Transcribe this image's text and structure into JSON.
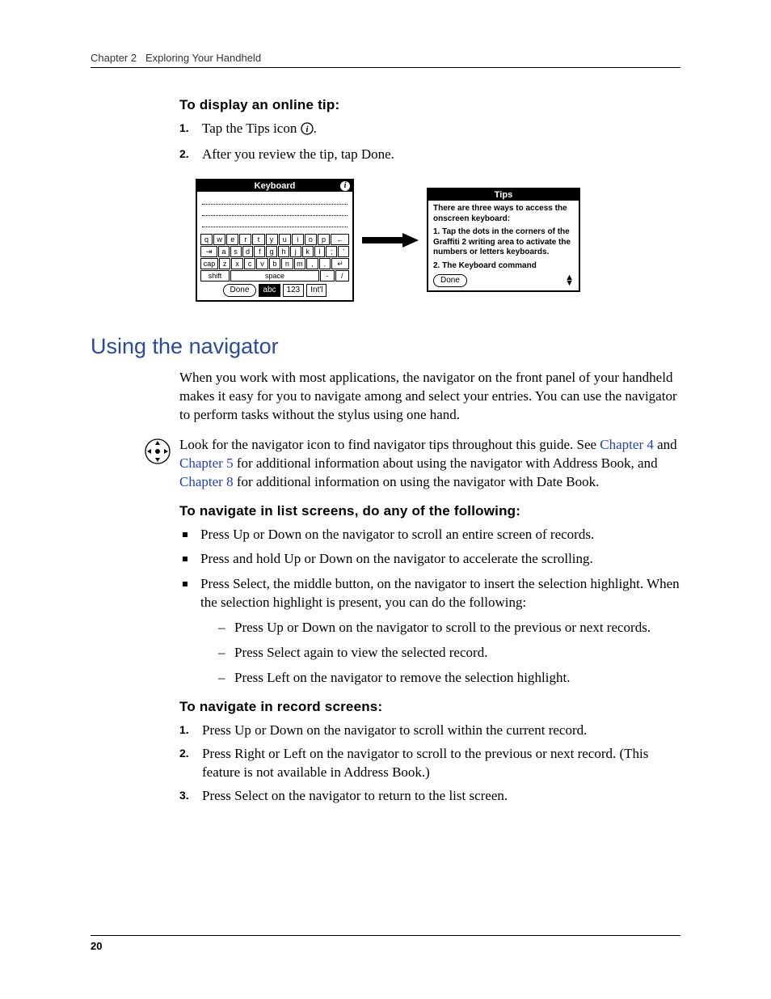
{
  "runningHead": {
    "chapter": "Chapter 2",
    "title": "Exploring Your Handheld"
  },
  "pageNumber": "20",
  "tip": {
    "heading": "To display an online tip:",
    "steps": [
      "Tap the Tips icon ",
      "After you review the tip, tap Done."
    ]
  },
  "figure": {
    "keyboard": {
      "title": "Keyboard",
      "rows": {
        "r1": [
          "q",
          "w",
          "e",
          "r",
          "t",
          "y",
          "u",
          "i",
          "o",
          "p",
          "←"
        ],
        "r2": [
          "⇥",
          "a",
          "s",
          "d",
          "f",
          "g",
          "h",
          "j",
          "k",
          "l",
          ";",
          "'"
        ],
        "r3": [
          "cap",
          "z",
          "x",
          "c",
          "v",
          "b",
          "n",
          "m",
          ",",
          ".",
          "↵"
        ],
        "r4_shift": "shift",
        "r4_space": "space",
        "r4_dash": "-",
        "r4_slash": "/"
      },
      "doneLabel": "Done",
      "modes": [
        "abc",
        "123",
        "Int'l"
      ]
    },
    "tips": {
      "title": "Tips",
      "para1": "There are three ways to access the onscreen keyboard:",
      "para2": "1. Tap the dots in the corners of the Graffiti 2 writing area to activate the numbers or letters keyboards.",
      "para3": "2. The Keyboard command",
      "doneLabel": "Done"
    }
  },
  "section": {
    "title": "Using the navigator",
    "intro": "When you work with most applications, the navigator on the front panel of your handheld makes it easy for you to navigate among and select your entries. You can use the navigator to perform tasks without the stylus using one hand.",
    "navPara": {
      "t1": "Look for the navigator icon to find navigator tips throughout this guide. See ",
      "link1": "Chapter 4",
      "t2": " and ",
      "link2": "Chapter 5",
      "t3": " for additional information about using the navigator with Address Book, and ",
      "link3": "Chapter 8",
      "t4": " for additional information on using the navigator with Date Book."
    },
    "listHeading": "To navigate in list screens, do any of the following:",
    "bullets": [
      "Press Up or Down on the navigator to scroll an entire screen of records.",
      "Press and hold Up or Down on the navigator to accelerate the scrolling.",
      "Press Select, the middle button, on the navigator to insert the selection highlight. When the selection highlight is present, you can do the following:"
    ],
    "dashes": [
      "Press Up or Down on the navigator to scroll to the previous or next records.",
      "Press Select again to view the selected record.",
      "Press Left on the navigator to remove the selection highlight."
    ],
    "recordHeading": "To navigate in record screens:",
    "recordSteps": [
      "Press Up or Down on the navigator to scroll within the current record.",
      "Press Right or Left on the navigator to scroll to the previous or next record. (This feature is not available in Address Book.)",
      "Press Select on the navigator to return to the list screen."
    ]
  }
}
